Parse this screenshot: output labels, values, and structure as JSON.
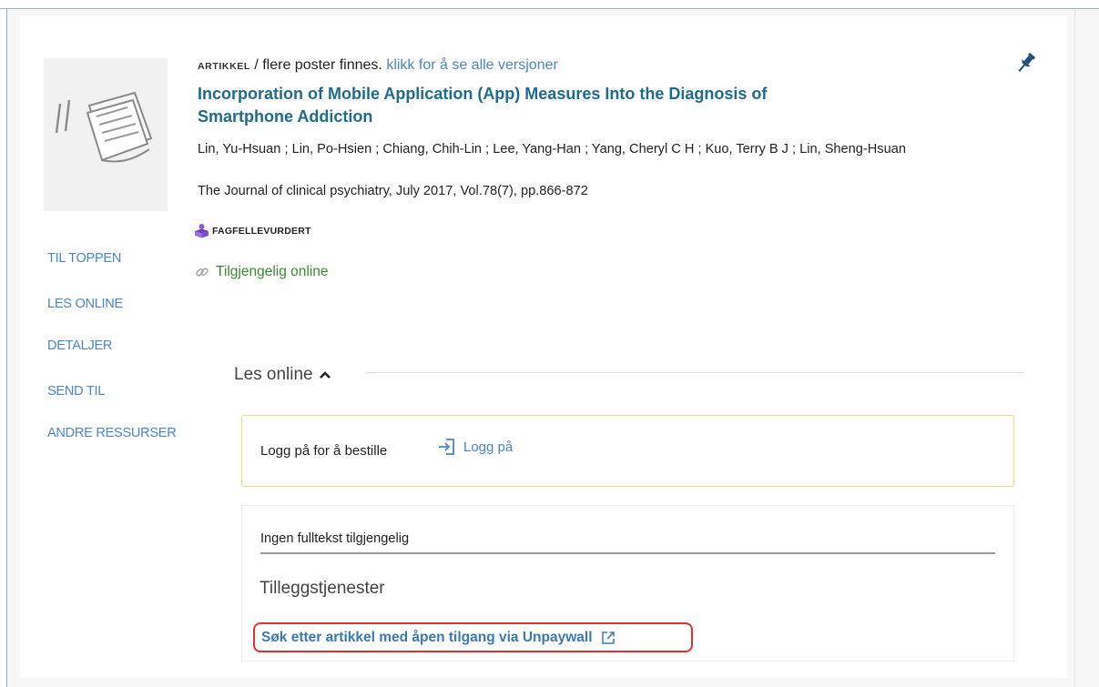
{
  "record": {
    "type_label": "ARTIKKEL",
    "versions_text": "/ flere poster finnes.",
    "versions_link": "klikk for å se alle versjoner",
    "title": "Incorporation of Mobile Application (App) Measures Into the Diagnosis of Smartphone Addiction",
    "authors": "Lin, Yu-Hsuan ; Lin, Po-Hsien ; Chiang, Chih-Lin ; Lee, Yang-Han ; Yang, Cheryl C H ; Kuo, Terry B J ; Lin, Sheng-Hsuan",
    "source": "The Journal of clinical psychiatry, July 2017, Vol.78(7), pp.866-872",
    "peer_reviewed": "FAGFELLEVURDERT",
    "availability": "Tilgjengelig online"
  },
  "sidenav": {
    "items": [
      "TIL TOPPEN",
      "LES ONLINE",
      "DETALJER",
      "SEND TIL",
      "ANDRE RESSURSER"
    ]
  },
  "read_online": {
    "heading": "Les online",
    "login_prompt": "Logg på for å bestille",
    "login_link": "Logg på",
    "no_fulltext": "Ingen fulltekst tilgjengelig",
    "services_heading": "Tilleggstjenester",
    "unpaywall_link": "Søk etter artikkel med åpen tilgang via Unpaywall"
  },
  "icons": {
    "pin": "pin-icon",
    "chevron": "chevron-up-icon",
    "link": "link-icon",
    "peer": "peer-reviewed-icon",
    "login": "login-icon",
    "external": "external-link-icon"
  },
  "colors": {
    "title": "#1f6b8d",
    "link": "#4a86c5",
    "available": "#3a8a2e",
    "highlight": "#e23030",
    "login_border": "#f0d98a"
  }
}
